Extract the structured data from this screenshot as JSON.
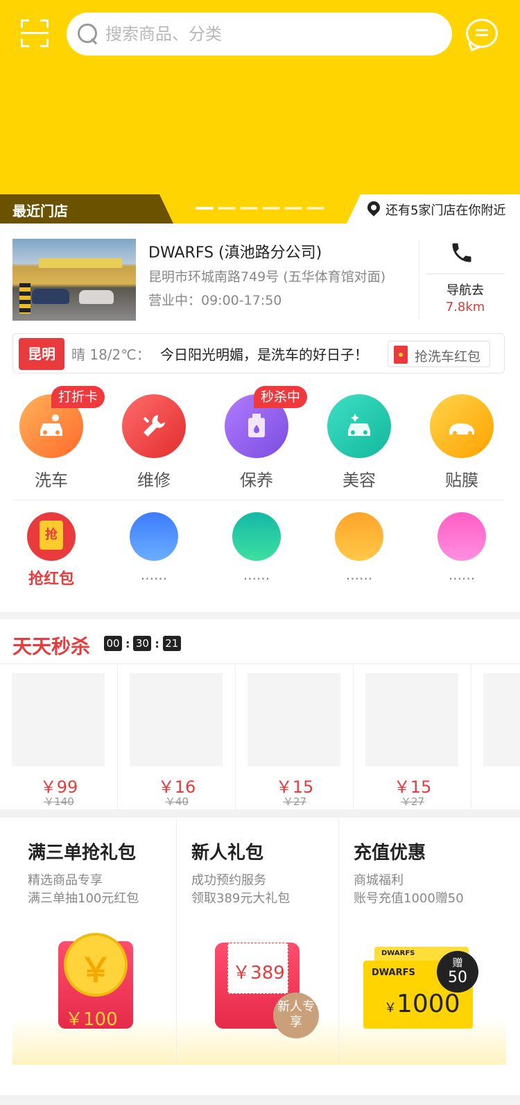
{
  "header": {
    "search_placeholder": "搜索商品、分类",
    "recent_store_label": "最近门店",
    "nearby_text": "还有5家门店在你附近",
    "carousel_count": 6,
    "carousel_active_index": 0,
    "colors": {
      "brand": "#ffd400",
      "accent": "#e93b3d",
      "strip_dark": "#6a5200"
    }
  },
  "store": {
    "name": "DWARFS (滇池路分公司)",
    "address": "昆明市环城南路749号 (五华体育馆对面)",
    "hours": "营业中：09:00-17:50",
    "nav_label": "导航去",
    "distance": "7.8km"
  },
  "weather": {
    "city": "昆明",
    "info": "晴 18/2℃：",
    "message": "今日阳光明媚，是洗车的好日子！",
    "redpacket_button": "抢洗车红包"
  },
  "categories": [
    {
      "label": "洗车",
      "badge": "打折卡",
      "icon": "car-wash-icon"
    },
    {
      "label": "维修",
      "badge": "",
      "icon": "wrench-icon"
    },
    {
      "label": "保养",
      "badge": "秒杀中",
      "icon": "oil-can-icon"
    },
    {
      "label": "美容",
      "badge": "",
      "icon": "car-sparkle-icon"
    },
    {
      "label": "贴膜",
      "badge": "",
      "icon": "car-film-icon"
    }
  ],
  "quick": [
    {
      "label": "抢红包",
      "icon_text": "抢"
    },
    {
      "label": "......"
    },
    {
      "label": "......"
    },
    {
      "label": "......"
    },
    {
      "label": "......"
    }
  ],
  "seckill": {
    "title": "天天秒杀",
    "timer": [
      "00",
      "30",
      "21"
    ],
    "items": [
      {
        "price": "￥99",
        "old": "￥140"
      },
      {
        "price": "￥16",
        "old": "￥40"
      },
      {
        "price": "￥15",
        "old": "￥27"
      },
      {
        "price": "￥15",
        "old": "￥27"
      }
    ]
  },
  "promos": [
    {
      "title": "满三单抢礼包",
      "line1": "精选商品专享",
      "line2": "满三单抽100元红包",
      "art_symbol": "￥",
      "art_amount": "￥100"
    },
    {
      "title": "新人礼包",
      "line1": "成功预约服务",
      "line2": "领取389元大礼包",
      "art_amount": "￥389",
      "art_badge": "新人专享"
    },
    {
      "title": "充值优惠",
      "line1": "商城福利",
      "line2": "账号充值1000赠50",
      "art_brand": "DWARFS",
      "art_amount": "1000",
      "art_currency": "￥",
      "art_badge_top": "赠",
      "art_badge_bottom": "50"
    }
  ]
}
